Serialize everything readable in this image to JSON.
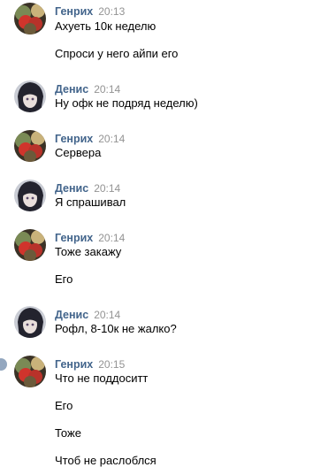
{
  "groups": [
    {
      "author": "Генрих",
      "time": "20:13",
      "avatar": "genrikh-avatar",
      "messages": [
        "Ахуеть 10к неделю",
        "Спроси у него айпи его"
      ]
    },
    {
      "author": "Денис",
      "time": "20:14",
      "avatar": "denis-avatar",
      "messages": [
        "Ну офк не подряд неделю)"
      ]
    },
    {
      "author": "Генрих",
      "time": "20:14",
      "avatar": "genrikh-avatar",
      "messages": [
        "Сервера"
      ]
    },
    {
      "author": "Денис",
      "time": "20:14",
      "avatar": "denis-avatar",
      "messages": [
        "Я спрашивал"
      ]
    },
    {
      "author": "Генрих",
      "time": "20:14",
      "avatar": "genrikh-avatar",
      "messages": [
        "Тоже закажу",
        "Его"
      ]
    },
    {
      "author": "Денис",
      "time": "20:14",
      "avatar": "denis-avatar",
      "messages": [
        "Рофл, 8-10к не жалко?"
      ]
    },
    {
      "author": "Генрих",
      "time": "20:15",
      "avatar": "genrikh-avatar",
      "messages": [
        "Что не поддоситт",
        "Его",
        "Тоже",
        "Чтоб не раслоблся"
      ]
    }
  ],
  "colors": {
    "author": "#42648b",
    "time": "#939393",
    "text": "#000000",
    "status_icon": "#93a7bf"
  }
}
